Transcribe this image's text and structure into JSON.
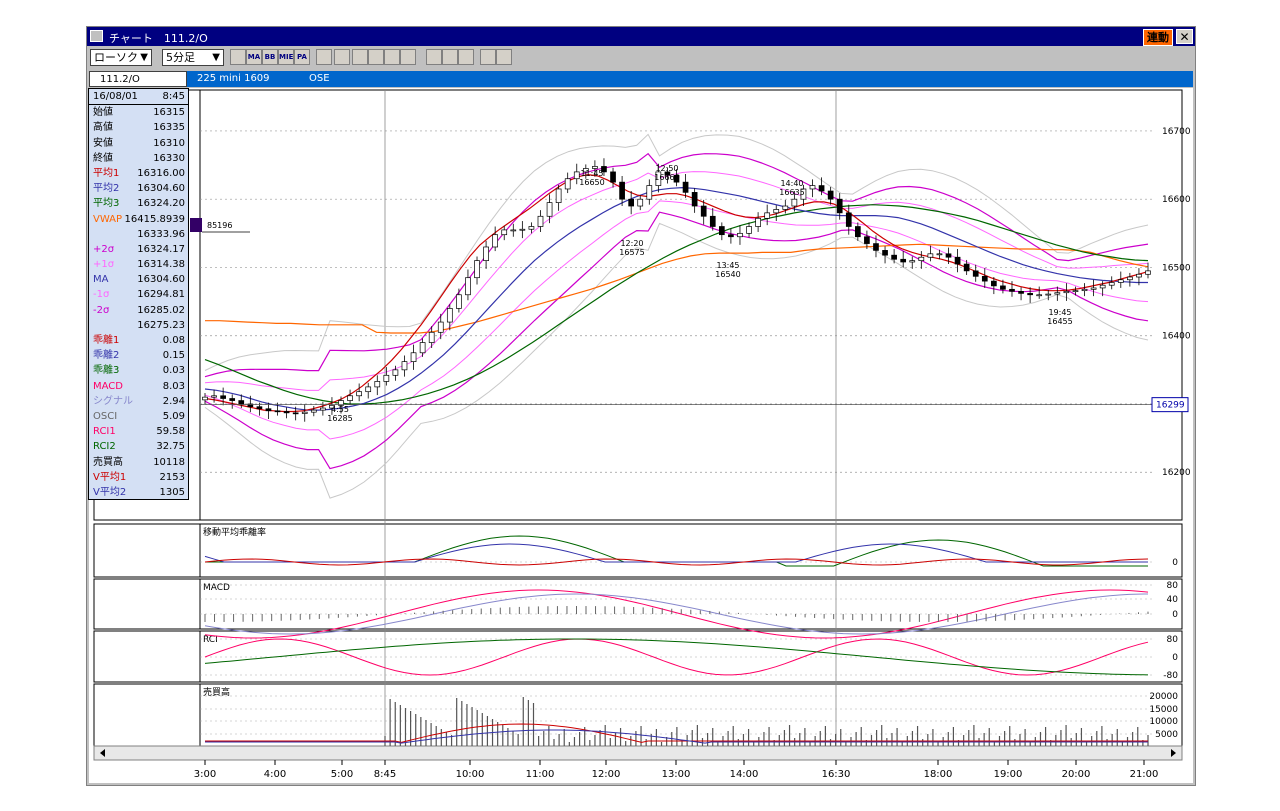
{
  "window": {
    "title": "チャート　111.2/O",
    "link_button": "連動",
    "close_glyph": "✕"
  },
  "toolbar": {
    "chart_type": "ローソク",
    "interval": "5分足",
    "icons": [
      "chart-settings-icon",
      "ma-icon",
      "bb-icon",
      "mie-icon",
      "pa-icon",
      "line-chart-icon",
      "point-figure-icon",
      "ichimoku-icon",
      "zoom-icon",
      "indicator-icon",
      "table-icon",
      "pen-icon",
      "cursor-icon",
      "eraser-icon",
      "magnify-icon",
      "trendline-icon"
    ],
    "icon_labels": [
      "",
      "MA",
      "BB",
      "MIE",
      "PA",
      "",
      "",
      "",
      "",
      "",
      "",
      "",
      "",
      "",
      "",
      ""
    ]
  },
  "infobar": {
    "symbol": "111.2/O",
    "contract": "225 mini 1609",
    "exchange": "OSE"
  },
  "data_panel": {
    "rows": [
      {
        "label": "16/08/01",
        "value": "8:45",
        "color": "#000000"
      },
      {
        "label": "始値",
        "value": "16315",
        "color": "#000000"
      },
      {
        "label": "高値",
        "value": "16335",
        "color": "#000000"
      },
      {
        "label": "安値",
        "value": "16310",
        "color": "#000000"
      },
      {
        "label": "終値",
        "value": "16330",
        "color": "#000000"
      },
      {
        "label": "平均1",
        "value": "16316.00",
        "color": "#cc0000"
      },
      {
        "label": "平均2",
        "value": "16304.60",
        "color": "#3333aa"
      },
      {
        "label": "平均3",
        "value": "16324.20",
        "color": "#006600"
      },
      {
        "label": "VWAP",
        "value": "16415.8939",
        "color": "#ff6600"
      },
      {
        "label": "",
        "value": "16333.96",
        "color": "#000000"
      },
      {
        "label": "+2σ",
        "value": "16324.17",
        "color": "#cc00cc"
      },
      {
        "label": "+1σ",
        "value": "16314.38",
        "color": "#ff66ff"
      },
      {
        "label": "MA",
        "value": "16304.60",
        "color": "#3333aa"
      },
      {
        "label": "-1σ",
        "value": "16294.81",
        "color": "#ff66ff"
      },
      {
        "label": "-2σ",
        "value": "16285.02",
        "color": "#cc00cc"
      },
      {
        "label": "",
        "value": "16275.23",
        "color": "#000000"
      },
      {
        "label": "乖離1",
        "value": "0.08",
        "color": "#cc0000"
      },
      {
        "label": "乖離2",
        "value": "0.15",
        "color": "#3333aa"
      },
      {
        "label": "乖離3",
        "value": "0.03",
        "color": "#006600"
      },
      {
        "label": "MACD",
        "value": "8.03",
        "color": "#ff0066"
      },
      {
        "label": "シグナル",
        "value": "2.94",
        "color": "#8888cc"
      },
      {
        "label": "OSCI",
        "value": "5.09",
        "color": "#666666"
      },
      {
        "label": "RCI1",
        "value": "59.58",
        "color": "#ff0066"
      },
      {
        "label": "RCI2",
        "value": "32.75",
        "color": "#006600"
      },
      {
        "label": "売買高",
        "value": "10118",
        "color": "#000000"
      },
      {
        "label": "V平均1",
        "value": "2153",
        "color": "#cc0000"
      },
      {
        "label": "V平均2",
        "value": "1305",
        "color": "#3333aa"
      }
    ]
  },
  "chart_data": [
    {
      "type": "candlestick",
      "title": "",
      "volume_profile_label": "85196",
      "y_ticks": [
        16200,
        16300,
        16400,
        16500,
        16600,
        16700
      ],
      "y_tick_labels": [
        "16200",
        "",
        "16400",
        "16500",
        "16600",
        "16700"
      ],
      "ylim": [
        16130,
        16760
      ],
      "current_price_label": "16299",
      "current_price": 16299,
      "x_tick_labels": [
        "3:00",
        "4:00",
        "5:00",
        "8:45",
        "10:00",
        "11:00",
        "12:00",
        "13:00",
        "14:00",
        "16:30",
        "18:00",
        "19:00",
        "20:00",
        "21:00"
      ],
      "annotations": [
        {
          "time": "4:55",
          "price": "16285"
        },
        {
          "time": "11:45",
          "price": "16650"
        },
        {
          "time": "12:50",
          "price": "16660"
        },
        {
          "time": "12:20",
          "price": "16575"
        },
        {
          "time": "13:45",
          "price": "16540"
        },
        {
          "time": "14:40",
          "price": "16635"
        },
        {
          "time": "19:45",
          "price": "16455"
        }
      ],
      "series_close": [
        16310,
        16312,
        16308,
        16305,
        16300,
        16296,
        16293,
        16290,
        16289,
        16287,
        16286,
        16288,
        16291,
        16294,
        16298,
        16305,
        16312,
        16318,
        16325,
        16333,
        16342,
        16350,
        16362,
        16375,
        16390,
        16405,
        16420,
        16440,
        16460,
        16485,
        16510,
        16530,
        16548,
        16555,
        16555,
        16556,
        16560,
        16575,
        16595,
        16615,
        16630,
        16640,
        16645,
        16648,
        16640,
        16625,
        16600,
        16590,
        16600,
        16620,
        16640,
        16635,
        16625,
        16610,
        16590,
        16575,
        16560,
        16548,
        16545,
        16550,
        16560,
        16572,
        16580,
        16585,
        16590,
        16600,
        16615,
        16620,
        16612,
        16600,
        16580,
        16560,
        16545,
        16535,
        16525,
        16518,
        16512,
        16508,
        16510,
        16515,
        16520,
        16520,
        16515,
        16505,
        16495,
        16487,
        16480,
        16473,
        16468,
        16465,
        16462,
        16460,
        16460,
        16461,
        16463,
        16465,
        16466,
        16468,
        16470,
        16474,
        16478,
        16482,
        16486,
        16490,
        16495
      ],
      "series_ma1": [
        16308,
        16306,
        16303,
        16300,
        16297,
        16294,
        16291,
        16290,
        16289,
        16289,
        16290,
        16293,
        16297,
        16302,
        16308,
        16316,
        16326,
        16338,
        16350,
        16364,
        16380,
        16398,
        16416,
        16436,
        16457,
        16478,
        16498,
        16517,
        16533,
        16545,
        16556,
        16566,
        16576,
        16586,
        16597,
        16608,
        16618,
        16627,
        16633,
        16636,
        16634,
        16628,
        16620,
        16612,
        16606,
        16604,
        16606,
        16608,
        16608,
        16605,
        16600,
        16594,
        16588,
        16582,
        16577,
        16574,
        16573,
        16575,
        16578,
        16583,
        16588,
        16593,
        16596,
        16596,
        16593,
        16586,
        16576,
        16565,
        16553,
        16543,
        16534,
        16527,
        16522,
        16518,
        16515,
        16512,
        16508,
        16503,
        16497,
        16491,
        16485,
        16480,
        16476,
        16472,
        16469,
        16467,
        16466,
        16466,
        16467,
        16469,
        16472,
        16475,
        16478,
        16482,
        16486,
        16490,
        16494
      ],
      "series_ma2": [
        16322,
        16320,
        16317,
        16313,
        16308,
        16303,
        16299,
        16296,
        16293,
        16291,
        16291,
        16292,
        16294,
        16297,
        16301,
        16307,
        16314,
        16323,
        16333,
        16345,
        16358,
        16372,
        16388,
        16405,
        16423,
        16441,
        16459,
        16477,
        16494,
        16510,
        16524,
        16537,
        16549,
        16560,
        16570,
        16580,
        16589,
        16597,
        16604,
        16610,
        16614,
        16616,
        16617,
        16616,
        16614,
        16611,
        16608,
        16605,
        16601,
        16597,
        16593,
        16589,
        16585,
        16582,
        16579,
        16577,
        16576,
        16576,
        16576,
        16576,
        16575,
        16573,
        16569,
        16564,
        16558,
        16551,
        16544,
        16537,
        16530,
        16523,
        16516,
        16510,
        16504,
        16499,
        16495,
        16491,
        16488,
        16485,
        16483,
        16481,
        16480,
        16479,
        16478,
        16478
      ],
      "series_ma3": [
        16365,
        16358,
        16350,
        16342,
        16334,
        16327,
        16320,
        16314,
        16309,
        16305,
        16302,
        16300,
        16300,
        16301,
        16303,
        16306,
        16310,
        16315,
        16321,
        16328,
        16336,
        16345,
        16355,
        16366,
        16378,
        16390,
        16403,
        16416,
        16429,
        16442,
        16455,
        16468,
        16480,
        16492,
        16503,
        16514,
        16524,
        16533,
        16541,
        16549,
        16556,
        16562,
        16567,
        16572,
        16576,
        16580,
        16583,
        16586,
        16588,
        16590,
        16591,
        16592,
        16591,
        16590,
        16588,
        16585,
        16582,
        16578,
        16574,
        16569,
        16563,
        16557,
        16551,
        16545,
        16539,
        16533,
        16528,
        16523,
        16519,
        16516,
        16513,
        16511,
        16510
      ],
      "series_vwap": [
        16422,
        16422,
        16421,
        16420,
        16419,
        16418,
        16418,
        16417,
        16416,
        16416,
        16416,
        16416,
        16405,
        16404,
        16404,
        16404,
        16406,
        16410,
        16415,
        16420,
        16426,
        16432,
        16438,
        16444,
        16450,
        16456,
        16462,
        16468,
        16475,
        16482,
        16490,
        16498,
        16506,
        16512,
        16517,
        16520,
        16521,
        16521,
        16521,
        16522,
        16522,
        16522,
        16525,
        16527,
        16528,
        16529,
        16530,
        16531,
        16532,
        16533,
        16534,
        16533,
        16532,
        16531,
        16530,
        16529,
        16528,
        16527,
        16527,
        16526,
        16526,
        16525,
        16522,
        16516,
        16510,
        16505,
        16501
      ]
    },
    {
      "type": "line",
      "title": "移動平均乖離率",
      "y_tick_labels": [
        "0"
      ]
    },
    {
      "type": "line",
      "title": "MACD",
      "y_tick_labels": [
        "80",
        "40",
        "0"
      ]
    },
    {
      "type": "line",
      "title": "RCI",
      "y_tick_labels": [
        "80",
        "0",
        "-80"
      ]
    },
    {
      "type": "bar",
      "title": "売買高",
      "y_tick_labels": [
        "20000",
        "15000",
        "10000",
        "5000"
      ]
    }
  ],
  "colors": {
    "title_bg": "#000080",
    "info_bg": "#0066cc",
    "panel_bg": "#d4e0f4",
    "bb_outer": "#cc00cc",
    "bb_inner": "#ff66ff",
    "ma1": "#cc0000",
    "ma2": "#3333aa",
    "ma3": "#006600",
    "vwap": "#ff6600"
  }
}
